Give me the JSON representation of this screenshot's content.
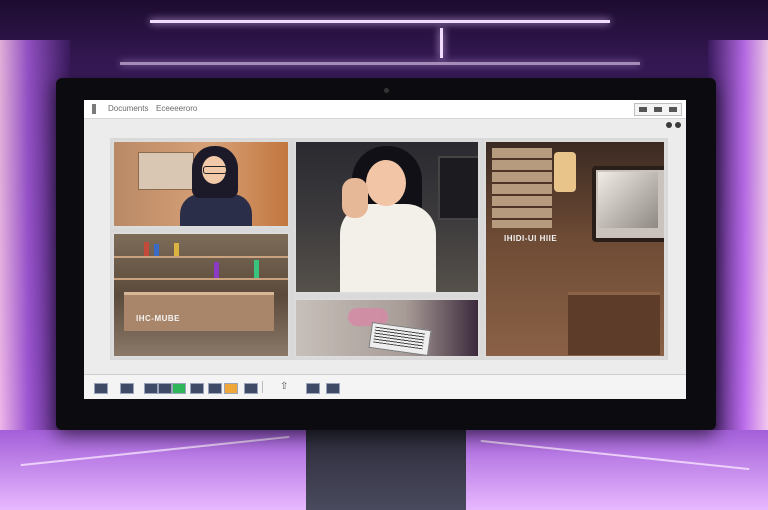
{
  "window": {
    "menu_items": [
      "Documents",
      "Eceeeeroro"
    ]
  },
  "tiles": [
    {
      "label": ""
    },
    {
      "label": "IHC-MUBE"
    },
    {
      "label": ""
    },
    {
      "label": ""
    },
    {
      "label": "IHIDI-UI HIIE"
    }
  ],
  "colors": {
    "background_accent": "#8b4ec8",
    "screen_bg": "#ececec",
    "monitor_bezel": "#0c0c10"
  },
  "taskbar": {
    "icons": [
      "app-icon-1",
      "app-icon-2",
      "app-icon-3",
      "app-icon-4",
      "green-app-icon",
      "app-icon-5",
      "app-icon-6",
      "app-icon-7",
      "app-icon-8",
      "arrow-icon",
      "app-icon-9",
      "app-icon-10"
    ]
  }
}
